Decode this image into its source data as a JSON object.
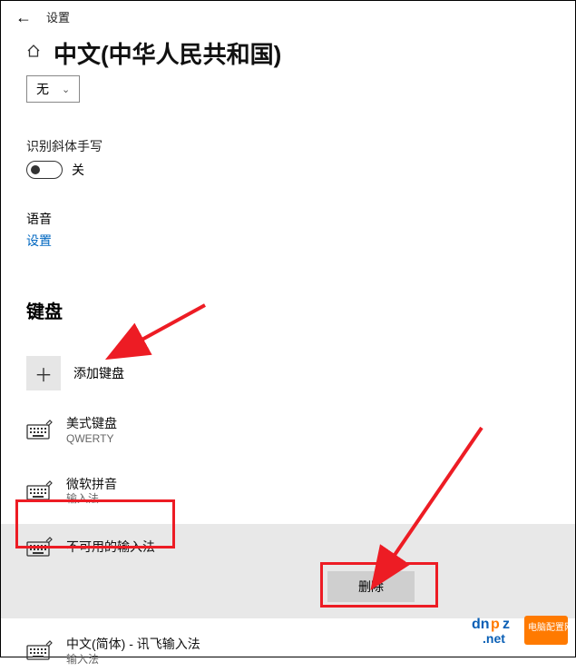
{
  "header": {
    "title": "设置"
  },
  "page_title": "中文(中华人民共和国)",
  "dropdown": {
    "selected": "无"
  },
  "slanted": {
    "label": "识别斜体手写",
    "state": "关"
  },
  "voice": {
    "label": "语音",
    "link": "设置"
  },
  "keyboard": {
    "heading": "键盘",
    "add_label": "添加键盘",
    "items": [
      {
        "title": "美式键盘",
        "sub": "QWERTY"
      },
      {
        "title": "微软拼音",
        "sub": "输入法"
      },
      {
        "title": "不可用的输入法",
        "sub": ""
      },
      {
        "title": "中文(简体) - 讯飞输入法",
        "sub": "输入法"
      }
    ],
    "delete_label": "删除"
  },
  "icons": {
    "back": "←",
    "home": "⌂",
    "plus": "＋",
    "chevron": "⌄"
  }
}
